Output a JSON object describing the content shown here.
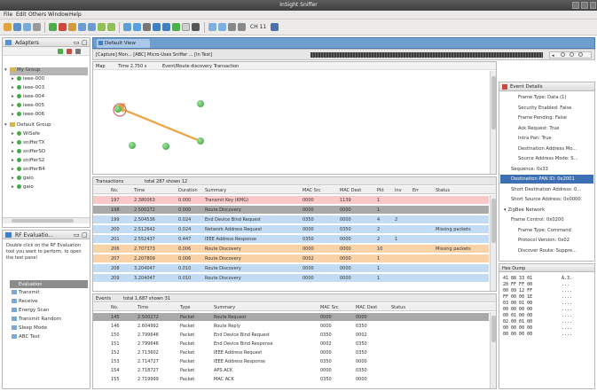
{
  "window": {
    "title": "InSight Sniffer"
  },
  "menu": [
    "File",
    "Edit",
    "Others",
    "Window",
    "Help"
  ],
  "toolbar": {
    "channel_label": "CH 11"
  },
  "adapters": {
    "title": "Adapters",
    "group1": "My Group",
    "group1_items": [
      "ieee-000",
      "ieee-003",
      "ieee-004",
      "ieee-005",
      "ieee-006"
    ],
    "group2": "Default Group",
    "group2_items": [
      "WiSafe",
      "snifferTX",
      "snifferSO",
      "snifferS2",
      "snifferB4",
      "gaio",
      "gaio"
    ]
  },
  "rf_evaluation": {
    "title": "RF Evaluatio...",
    "description": "Double click on the RF Evaluation tool you want to perform, to open the test panel",
    "section": "Evaluation",
    "items": [
      "Transmit",
      "Receive",
      "Energy Scan",
      "Transmit Random",
      "Sleep Mode",
      "ABC Test"
    ]
  },
  "editor_tab": "Default View",
  "capture_bar": "[Capture] Mon... [ABC] Micro-Uses Sniffer ... [In Test]",
  "map": {
    "header": [
      {
        "text": "Map"
      },
      {
        "text": "Time 2.750 s"
      },
      {
        "text": "Event/Route discovery Transaction"
      }
    ]
  },
  "transactions": {
    "label": "Transactions",
    "count_label": "total 287 shown 12",
    "columns": [
      "No.",
      "Time",
      "Duration",
      "Summary",
      "MAC Src",
      "MAC Dest",
      "Pkt",
      "Inv",
      "Err",
      "Status"
    ],
    "rows": [
      {
        "no": "197",
        "time": "2.380063",
        "dur": "0.000",
        "summary": "Transmit Key (KMG)",
        "src": "0000",
        "dst": "1139",
        "pkt": "1",
        "inv": "",
        "err": "",
        "status": "",
        "bg": "#f9c9c9"
      },
      {
        "no": "198",
        "time": "2.500272",
        "dur": "0.000",
        "summary": "Route Discovery",
        "src": "0000",
        "dst": "0000",
        "pkt": "1",
        "inv": "",
        "err": "",
        "status": "",
        "bg": "#a9a9a9"
      },
      {
        "no": "199",
        "time": "2.504536",
        "dur": "0.024",
        "summary": "End Device Bind Request",
        "src": "0350",
        "dst": "0000",
        "pkt": "4",
        "inv": "2",
        "err": "",
        "status": "",
        "bg": "#c3dbf3"
      },
      {
        "no": "200",
        "time": "2.512642",
        "dur": "0.024",
        "summary": "Network Address Request",
        "src": "0000",
        "dst": "0350",
        "pkt": "2",
        "inv": "",
        "err": "",
        "status": "Missing packets",
        "bg": "#c3dbf3"
      },
      {
        "no": "201",
        "time": "2.552437",
        "dur": "0.447",
        "summary": "IEEE Address Response",
        "src": "0350",
        "dst": "0000",
        "pkt": "2",
        "inv": "1",
        "err": "",
        "status": "",
        "bg": "#c3dbf3"
      },
      {
        "no": "206",
        "time": "2.707373",
        "dur": "0.006",
        "summary": "Route Discovery",
        "src": "0000",
        "dst": "0000",
        "pkt": "10",
        "inv": "",
        "err": "",
        "status": "Missing packets",
        "bg": "#f9d2a8"
      },
      {
        "no": "207",
        "time": "2.207809",
        "dur": "0.006",
        "summary": "Route Discovery",
        "src": "0002",
        "dst": "0000",
        "pkt": "1",
        "inv": "",
        "err": "",
        "status": "",
        "bg": "#f9d2a8"
      },
      {
        "no": "208",
        "time": "3.204047",
        "dur": "0.010",
        "summary": "Route Discovery",
        "src": "0000",
        "dst": "0000",
        "pkt": "1",
        "inv": "",
        "err": "",
        "status": "",
        "bg": "#c3dbf3"
      },
      {
        "no": "209",
        "time": "3.204047",
        "dur": "0.010",
        "summary": "Route Discovery",
        "src": "0000",
        "dst": "0000",
        "pkt": "1",
        "inv": "",
        "err": "",
        "status": "",
        "bg": "#c3dbf3"
      }
    ]
  },
  "events": {
    "label": "Events",
    "count_label": "total 1,687 shown 31",
    "columns": [
      "No.",
      "Time",
      "Type",
      "Summary",
      "MAC Src",
      "MAC Dest",
      "Status"
    ],
    "rows": [
      {
        "no": "145",
        "time": "2.500272",
        "type": "Packet",
        "summary": "Route Request",
        "src": "0000",
        "dst": "0000",
        "status": "",
        "bg": "#a9a9a9"
      },
      {
        "no": "146",
        "time": "2.604992",
        "type": "Packet",
        "summary": "Route Reply",
        "src": "0000",
        "dst": "0350",
        "status": "",
        "bg": "#ffffff"
      },
      {
        "no": "150",
        "time": "2.799646",
        "type": "Packet",
        "summary": "End Device Bind Request",
        "src": "0350",
        "dst": "0002",
        "status": "",
        "bg": "#ffffff"
      },
      {
        "no": "151",
        "time": "2.799646",
        "type": "Packet",
        "summary": "End Device Bind Response",
        "src": "0002",
        "dst": "0350",
        "status": "",
        "bg": "#ffffff"
      },
      {
        "no": "152",
        "time": "2.713602",
        "type": "Packet",
        "summary": "IEEE Address Request",
        "src": "0000",
        "dst": "0350",
        "status": "",
        "bg": "#ffffff"
      },
      {
        "no": "153",
        "time": "2.714727",
        "type": "Packet",
        "summary": "IEEE Address Response",
        "src": "0350",
        "dst": "0000",
        "status": "",
        "bg": "#ffffff"
      },
      {
        "no": "154",
        "time": "2.718727",
        "type": "Packet",
        "summary": "APS ACK",
        "src": "0000",
        "dst": "0350",
        "status": "",
        "bg": "#ffffff"
      },
      {
        "no": "155",
        "time": "2.719999",
        "type": "Packet",
        "summary": "MAC ACK",
        "src": "0350",
        "dst": "0000",
        "status": "",
        "bg": "#ffffff"
      }
    ]
  },
  "decode": {
    "title": "Event Details",
    "lines": [
      {
        "text": "Frame Type: Data (1)",
        "indent": 2,
        "sel": false
      },
      {
        "text": "Security Enabled: False",
        "indent": 2,
        "sel": false
      },
      {
        "text": "Frame Pending: False",
        "indent": 2,
        "sel": false
      },
      {
        "text": "Ack Request: True",
        "indent": 2,
        "sel": false
      },
      {
        "text": "Intra Pan: True",
        "indent": 2,
        "sel": false
      },
      {
        "text": "Destination Address Mo...",
        "indent": 2,
        "sel": false
      },
      {
        "text": "Source Address Mode: S...",
        "indent": 2,
        "sel": false
      },
      {
        "text": "Sequence: 0x33",
        "indent": 1,
        "sel": false
      },
      {
        "text": "Destination PAN ID: 0x2001",
        "indent": 1,
        "sel": true
      },
      {
        "text": "Short Destination Address: 0...",
        "indent": 1,
        "sel": false
      },
      {
        "text": "Short Source Address: 0x0000",
        "indent": 1,
        "sel": false
      },
      {
        "text": "ZigBee Network",
        "indent": 0,
        "sel": false
      },
      {
        "text": "Frame Control: 0x0200",
        "indent": 1,
        "sel": false
      },
      {
        "text": "Frame Type: Command",
        "indent": 2,
        "sel": false
      },
      {
        "text": "Protocol Version: 0x02",
        "indent": 2,
        "sel": false
      },
      {
        "text": "Discover Route: Suppre...",
        "indent": 2,
        "sel": false
      }
    ]
  },
  "hex": {
    "title": "Hex Dump",
    "lines": [
      "41 88 33 01",
      "20 FF FF 00",
      "00 09 12 FF",
      "FF 00 00 1E",
      "03 00 01 00",
      "00 00 00 00",
      "00 01 00 00",
      "02 00 01 00",
      "00 00 00 00",
      "00 00 00 00"
    ],
    "ascii": [
      "A.3.",
      " ...",
      "....",
      "....",
      "....",
      "....",
      "....",
      "....",
      "....",
      "...."
    ]
  }
}
